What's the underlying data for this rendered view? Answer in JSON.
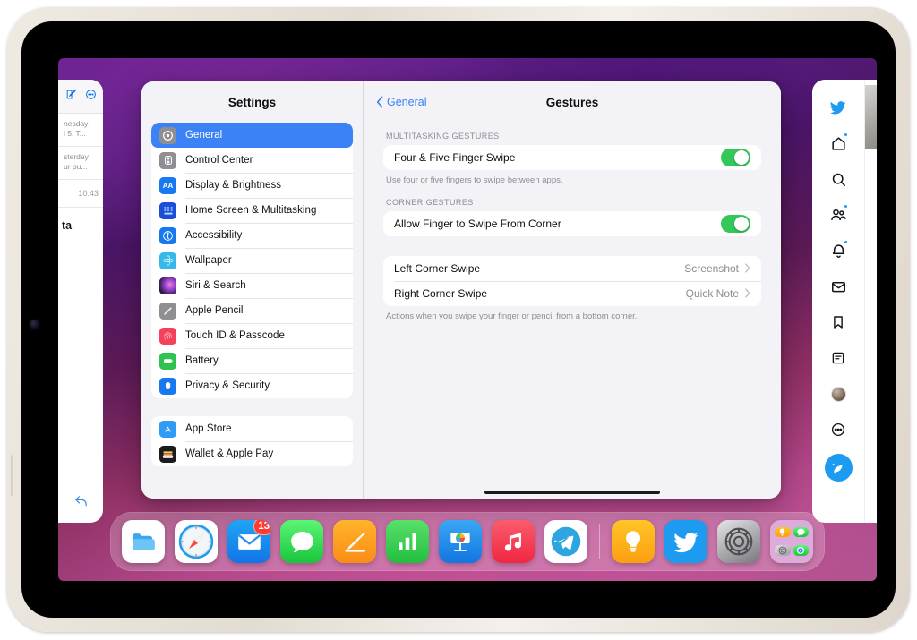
{
  "device": {
    "name": "iPad",
    "orientation": "landscape"
  },
  "mail_app": {
    "name": "Mail",
    "toolbar": {
      "compose_icon": "compose-icon",
      "more_icon": "more-circle-icon"
    },
    "rows": [
      {
        "line1": "nesday",
        "line2": "l 5. T..."
      },
      {
        "line1": "sterday",
        "line2": "ur pu..."
      }
    ],
    "timestamp": "10:43",
    "body_title": "ta",
    "reply_icon": "reply-arrow-icon"
  },
  "settings": {
    "sidebar": {
      "title": "Settings",
      "groups": [
        {
          "items": [
            {
              "label": "General",
              "icon": "gear-icon",
              "color": "#8e8e93",
              "selected": true
            },
            {
              "label": "Control Center",
              "icon": "sliders-icon",
              "color": "#8e8e93",
              "selected": false
            },
            {
              "label": "Display & Brightness",
              "icon": "aa-text-icon",
              "color": "#1878f0",
              "selected": false
            },
            {
              "label": "Home Screen & Multitasking",
              "icon": "home-grid-icon",
              "color": "#1d4ed8",
              "selected": false
            },
            {
              "label": "Accessibility",
              "icon": "accessibility-icon",
              "color": "#1878f0",
              "selected": false
            },
            {
              "label": "Wallpaper",
              "icon": "flower-icon",
              "color": "#35b9e8",
              "selected": false
            },
            {
              "label": "Siri & Search",
              "icon": "siri-icon",
              "color": "#2b1a3a",
              "selected": false
            },
            {
              "label": "Apple Pencil",
              "icon": "pencil-icon",
              "color": "#8e8e93",
              "selected": false
            },
            {
              "label": "Touch ID & Passcode",
              "icon": "fingerprint-icon",
              "color": "#f4425a",
              "selected": false
            },
            {
              "label": "Battery",
              "icon": "battery-icon",
              "color": "#30c24e",
              "selected": false
            },
            {
              "label": "Privacy & Security",
              "icon": "hand-icon",
              "color": "#1878f0",
              "selected": false
            }
          ]
        },
        {
          "items": [
            {
              "label": "App Store",
              "icon": "app-store-icon",
              "color": "#2f9bf5",
              "selected": false
            },
            {
              "label": "Wallet & Apple Pay",
              "icon": "wallet-icon",
              "color": "#1c1c1e",
              "selected": false
            }
          ]
        }
      ]
    },
    "detail": {
      "back_label": "General",
      "title": "Gestures",
      "sections": [
        {
          "header": "Multitasking Gestures",
          "rows": [
            {
              "label": "Four & Five Finger Swipe",
              "type": "toggle",
              "value": "on"
            }
          ],
          "footnote": "Use four or five fingers to swipe between apps."
        },
        {
          "header": "Corner Gestures",
          "rows": [
            {
              "label": "Allow Finger to Swipe From Corner",
              "type": "toggle",
              "value": "on"
            }
          ],
          "footnote": ""
        },
        {
          "header": "",
          "rows": [
            {
              "label": "Left Corner Swipe",
              "type": "disclosure",
              "value": "Screenshot"
            },
            {
              "label": "Right Corner Swipe",
              "type": "disclosure",
              "value": "Quick Note"
            }
          ],
          "footnote": "Actions when you swipe your finger or pencil from a bottom corner."
        }
      ]
    }
  },
  "twitter_app": {
    "name": "Twitter",
    "nav_items": [
      {
        "icon": "twitter-bird-icon",
        "badge": false
      },
      {
        "icon": "home-icon",
        "badge": true
      },
      {
        "icon": "search-icon",
        "badge": false
      },
      {
        "icon": "communities-icon",
        "badge": true
      },
      {
        "icon": "bell-icon",
        "badge": true
      },
      {
        "icon": "envelope-icon",
        "badge": false
      },
      {
        "icon": "bookmark-icon",
        "badge": false
      },
      {
        "icon": "lists-icon",
        "badge": false
      },
      {
        "icon": "profile-avatar-icon",
        "badge": false
      },
      {
        "icon": "more-circle-icon",
        "badge": false
      }
    ],
    "compose_icon": "compose-feather-icon",
    "accent_color": "#1d9bf0"
  },
  "dock": {
    "apps": [
      {
        "name": "Files",
        "icon": "files-icon"
      },
      {
        "name": "Safari",
        "icon": "safari-icon"
      },
      {
        "name": "Mail",
        "icon": "mail-icon",
        "badge": "13"
      },
      {
        "name": "Messages",
        "icon": "messages-icon"
      },
      {
        "name": "Notes",
        "icon": "notes-icon"
      },
      {
        "name": "Numbers",
        "icon": "numbers-icon"
      },
      {
        "name": "Keynote",
        "icon": "keynote-icon"
      },
      {
        "name": "Music",
        "icon": "music-icon"
      },
      {
        "name": "Telegram",
        "icon": "telegram-icon"
      }
    ],
    "recent_apps": [
      {
        "name": "Ideas",
        "icon": "lightbulb-icon"
      },
      {
        "name": "Twitter",
        "icon": "twitter-icon"
      },
      {
        "name": "Settings",
        "icon": "settings-gear-icon"
      },
      {
        "name": "Folder",
        "icon": "app-folder-icon"
      }
    ]
  }
}
